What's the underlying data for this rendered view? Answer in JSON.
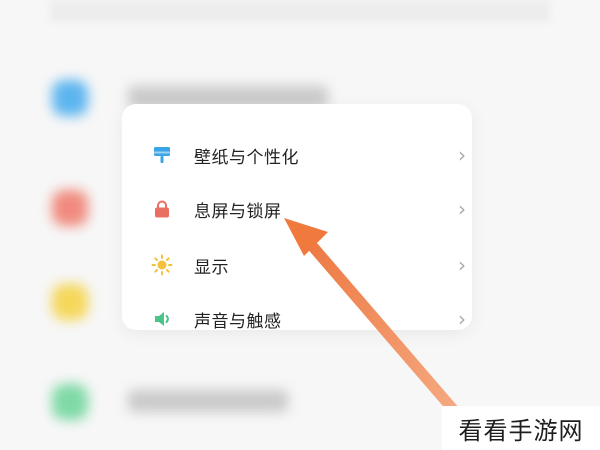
{
  "menu": {
    "items": [
      {
        "label": "壁纸与个性化",
        "icon": "wallpaper-icon",
        "color": "#3aa4e6"
      },
      {
        "label": "息屏与锁屏",
        "icon": "lock-icon",
        "color": "#e96f63"
      },
      {
        "label": "显示",
        "icon": "sun-icon",
        "color": "#f2c23c"
      },
      {
        "label": "声音与触感",
        "icon": "speaker-icon",
        "color": "#4cc38a"
      }
    ],
    "chevron": "›"
  },
  "background_icon_colors": [
    "#5db5ef",
    "#f08b7e",
    "#f5d75a",
    "#7fd9a6"
  ],
  "arrow_color": "#f07a3e",
  "watermark": "看看手游网"
}
